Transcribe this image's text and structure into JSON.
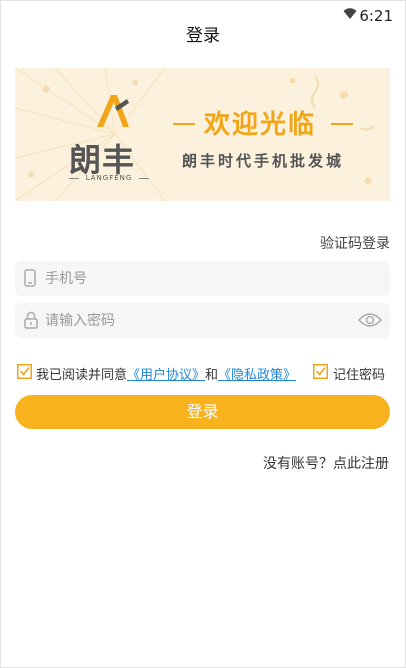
{
  "status_bar": {
    "time": "6:21",
    "wifi_icon": "wifi-icon"
  },
  "header": {
    "title": "登录"
  },
  "banner": {
    "brand_name": "朗丰",
    "brand_sub": "LANGFENG",
    "welcome": "欢迎光临",
    "slogan": "朗丰时代手机批发城",
    "accent_color": "#f2a516",
    "background_color": "#fbf1dd"
  },
  "form": {
    "switch_mode_label": "验证码登录",
    "phone_placeholder": "手机号",
    "phone_value": "",
    "password_placeholder": "请输入密码",
    "password_value": "",
    "agree_prefix": "我已阅读并同意",
    "user_agreement": "《用户协议》",
    "and_text": "和",
    "privacy_policy": "《隐私政策》",
    "remember_label": "记住密码",
    "login_button": "登录",
    "register_link": "没有账号？点此注册"
  },
  "colors": {
    "primary": "#f7b21e",
    "link": "#1f86d6",
    "input_bg": "#f6f6f6"
  }
}
